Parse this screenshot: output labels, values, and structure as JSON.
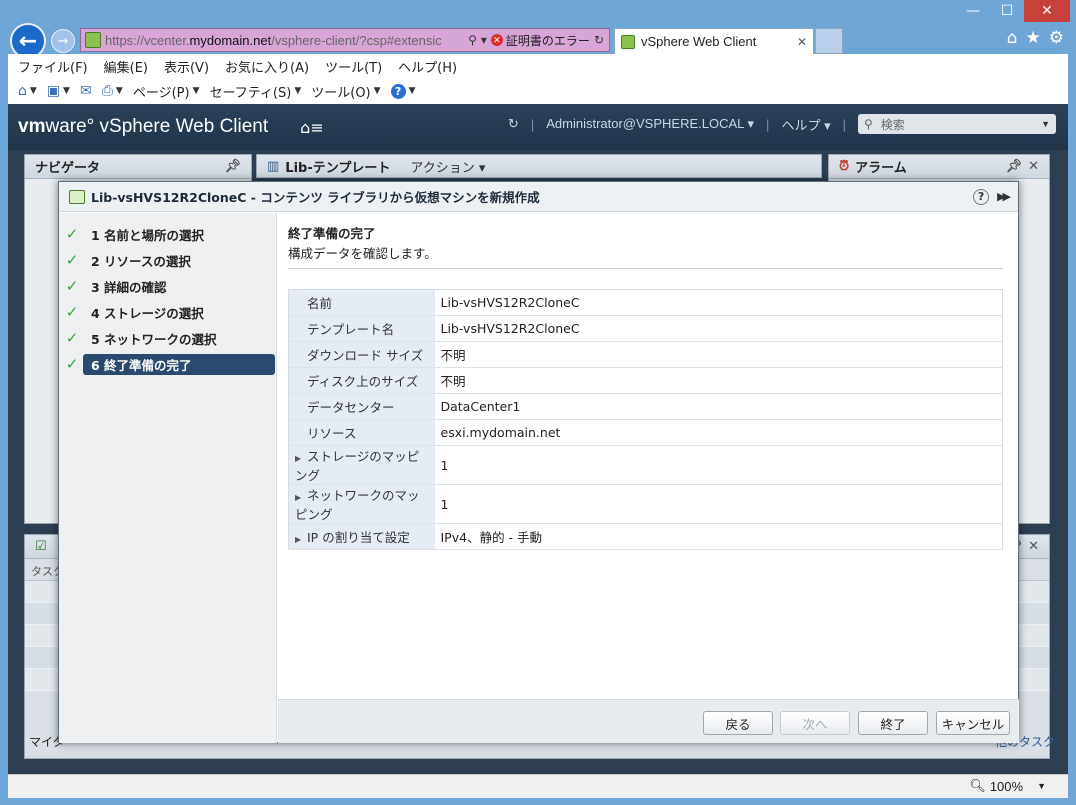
{
  "browser": {
    "window_controls": {
      "minimize": "—",
      "restore": "☐",
      "close": "✕"
    },
    "url_prefix": "https://vcenter.",
    "url_domain": "mydomain.net",
    "url_rest": "/vsphere-client/?csp#extensic",
    "cert_error": "証明書のエラー",
    "tab_title": "vSphere Web Client",
    "menu": [
      "ファイル(F)",
      "編集(E)",
      "表示(V)",
      "お気に入り(A)",
      "ツール(T)",
      "ヘルプ(H)"
    ],
    "commands": {
      "page": "ページ(P)",
      "safety": "セーフティ(S)",
      "tools": "ツール(O)"
    },
    "zoom": "100%"
  },
  "vsphere": {
    "logo_vm": "vm",
    "logo_rest": "ware° vSphere Web Client",
    "user": "Administrator@VSPHERE.LOCAL",
    "help": "ヘルプ",
    "search_placeholder": "検索",
    "navigator_title": "ナビゲータ",
    "center_title": "Lib-テンプレート",
    "actions": "アクション",
    "alarm_title": "アラーム",
    "tasks_col": "タスク",
    "tasks_footer_left": "マイタ",
    "tasks_footer_right": "他のタスク"
  },
  "dialog": {
    "title": "Lib-vsHVS12R2CloneC - コンテンツ ライブラリから仮想マシンを新規作成",
    "steps": [
      {
        "label": "1 名前と場所の選択"
      },
      {
        "label": "2 リソースの選択"
      },
      {
        "label": "3 詳細の確認"
      },
      {
        "label": "4 ストレージの選択"
      },
      {
        "label": "5 ネットワークの選択"
      },
      {
        "label": "6 終了準備の完了"
      }
    ],
    "content_title": "終了準備の完了",
    "content_subtitle": "構成データを確認します。",
    "summary": [
      {
        "key": "名前",
        "value": "Lib-vsHVS12R2CloneC"
      },
      {
        "key": "テンプレート名",
        "value": "Lib-vsHVS12R2CloneC"
      },
      {
        "key": "ダウンロード サイズ",
        "value": "不明"
      },
      {
        "key": "ディスク上のサイズ",
        "value": "不明"
      },
      {
        "key": "データセンター",
        "value": "DataCenter1"
      },
      {
        "key": "リソース",
        "value": "esxi.mydomain.net"
      },
      {
        "key": "ストレージのマッピング",
        "value": "1"
      },
      {
        "key": "ネットワークのマッピング",
        "value": "1"
      },
      {
        "key": "IP の割り当て設定",
        "value": "IPv4、静的 - 手動"
      }
    ],
    "buttons": {
      "back": "戻る",
      "next": "次へ",
      "finish": "終了",
      "cancel": "キャンセル"
    }
  }
}
